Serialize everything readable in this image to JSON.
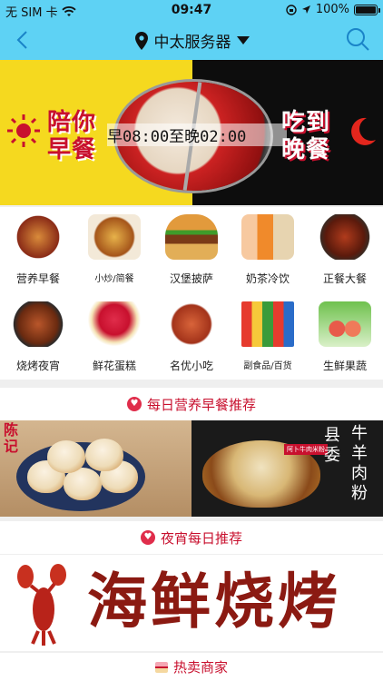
{
  "status_bar": {
    "carrier": "无 SIM 卡",
    "time": "09:47",
    "battery": "100%",
    "battery_level": 1.0
  },
  "nav": {
    "title": "中太服务器",
    "back_icon": "chevron-left-icon",
    "search_icon": "search-icon",
    "location_icon": "location-pin-icon",
    "dropdown_icon": "triangle-down-icon"
  },
  "banner": {
    "left_line1": "陪你",
    "left_line2": "早餐",
    "hours": "早08:00至晚02:00",
    "right_line1": "吃到",
    "right_line2": "晚餐"
  },
  "categories": [
    {
      "label": "营养早餐"
    },
    {
      "label": "小炒/简餐"
    },
    {
      "label": "汉堡披萨"
    },
    {
      "label": "奶茶冷饮"
    },
    {
      "label": "正餐大餐"
    },
    {
      "label": "烧烤夜宵"
    },
    {
      "label": "鲜花蛋糕"
    },
    {
      "label": "名优小吃"
    },
    {
      "label": "副食品/百货"
    },
    {
      "label": "生鲜果蔬"
    }
  ],
  "sections": {
    "breakfast": "每日营养早餐推荐",
    "night": "夜宵每日推荐",
    "hot": "热卖商家"
  },
  "breakfast_banner": {
    "left_brand": "陈记",
    "right_tag": "阿卜牛肉米粉",
    "right_col1": "县委",
    "right_col2": "牛羊肉粉"
  },
  "seafood_banner": {
    "text": "海鲜烧烤"
  },
  "colors": {
    "nav_bg": "#5ed2f4",
    "accent_red": "#c8102e",
    "banner_yellow": "#f5d91f"
  }
}
